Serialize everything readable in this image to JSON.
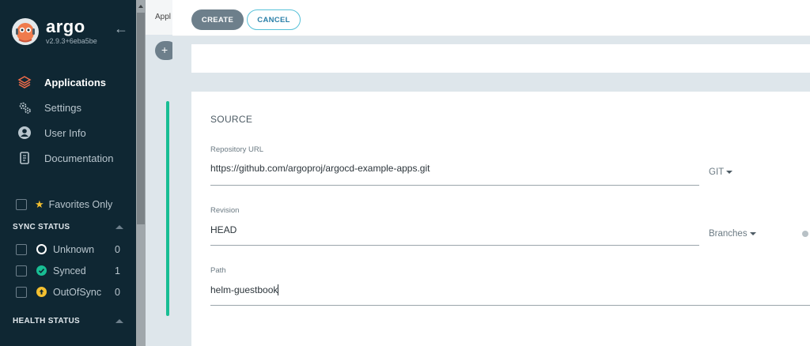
{
  "app": {
    "name": "argo",
    "version": "v2.9.3+6eba5be"
  },
  "sidebar": {
    "nav": [
      {
        "label": "Applications",
        "icon": "layers-icon",
        "active": true
      },
      {
        "label": "Settings",
        "icon": "gears-icon",
        "active": false
      },
      {
        "label": "User Info",
        "icon": "user-circle-icon",
        "active": false
      },
      {
        "label": "Documentation",
        "icon": "book-icon",
        "active": false
      }
    ],
    "favorites_label": "Favorites Only",
    "sync_status": {
      "title": "SYNC STATUS",
      "items": [
        {
          "label": "Unknown",
          "count": "0",
          "color": "#ffffff"
        },
        {
          "label": "Synced",
          "count": "1",
          "color": "#18be94"
        },
        {
          "label": "OutOfSync",
          "count": "0",
          "color": "#f4c030"
        }
      ]
    },
    "health_status": {
      "title": "HEALTH STATUS"
    }
  },
  "underlying": {
    "tab_label": "Appl",
    "plus": "+"
  },
  "toolbar": {
    "create_label": "CREATE",
    "cancel_label": "CANCEL"
  },
  "source": {
    "title": "SOURCE",
    "repo_url_label": "Repository URL",
    "repo_url_value": "https://github.com/argoproj/argocd-example-apps.git",
    "repo_type": "GIT",
    "revision_label": "Revision",
    "revision_value": "HEAD",
    "revision_type": "Branches",
    "path_label": "Path",
    "path_value": "helm-guestbook"
  },
  "colors": {
    "sidebar_bg": "#0f2733",
    "accent_teal": "#18be94",
    "create_button": "#6d7f8b",
    "cancel_border": "#56c1d8",
    "apps_icon": "#ef6c4a"
  }
}
